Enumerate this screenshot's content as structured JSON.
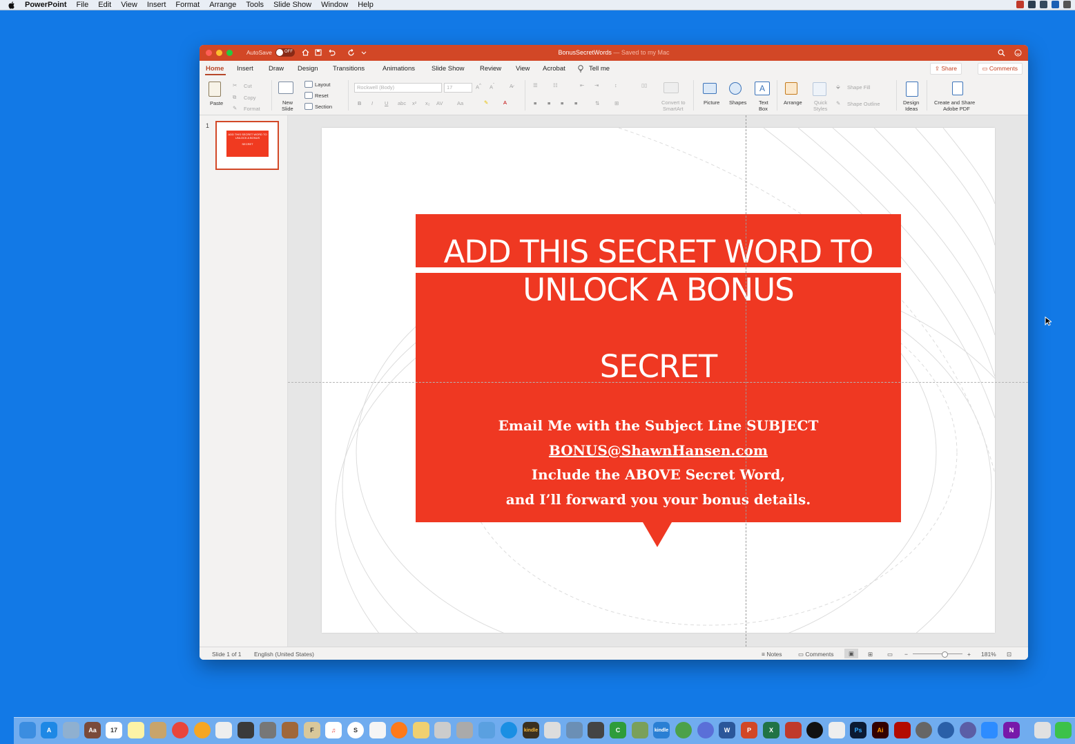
{
  "menubar": {
    "app_name": "PowerPoint",
    "items": [
      "File",
      "Edit",
      "View",
      "Insert",
      "Format",
      "Arrange",
      "Tools",
      "Slide Show",
      "Window",
      "Help"
    ]
  },
  "titlebar": {
    "autosave_label": "AutoSave",
    "autosave_state": "OFF",
    "document_name": "BonusSecretWords",
    "save_status": "— Saved to my Mac",
    "accent_color": "#d24726"
  },
  "tabs": {
    "items": [
      "Home",
      "Insert",
      "Draw",
      "Design",
      "Transitions",
      "Animations",
      "Slide Show",
      "Review",
      "View",
      "Acrobat"
    ],
    "active": "Home",
    "tell_me": "Tell me",
    "share_label": "Share",
    "comments_label": "Comments"
  },
  "ribbon": {
    "paste": "Paste",
    "cut": "Cut",
    "copy": "Copy",
    "format": "Format",
    "new_slide_1": "New",
    "new_slide_2": "Slide",
    "layout": "Layout",
    "reset": "Reset",
    "section": "Section",
    "font_name": "Rockwell (Body)",
    "font_size": "17",
    "convert_smartart_1": "Convert to",
    "convert_smartart_2": "SmartArt",
    "picture": "Picture",
    "shapes": "Shapes",
    "text_box_1": "Text",
    "text_box_2": "Box",
    "arrange": "Arrange",
    "quick_styles_1": "Quick",
    "quick_styles_2": "Styles",
    "shape_fill": "Shape Fill",
    "shape_outline": "Shape Outline",
    "design_ideas_1": "Design",
    "design_ideas_2": "Ideas",
    "adobe_pdf_1": "Create and Share",
    "adobe_pdf_2": "Adobe PDF"
  },
  "thumbnails": {
    "slide_number": "1",
    "thumb_line1": "ADD THIS SECRET WORD TO",
    "thumb_line2": "UNLOCK A BONUS",
    "thumb_line3": "SECRET"
  },
  "slide": {
    "headline_line1": "ADD THIS SECRET WORD TO",
    "headline_line2": "UNLOCK A BONUS",
    "secret_word": "SECRET",
    "line1": "Email Me with the Subject Line SUBJECT",
    "email": "BONUS@ShawnHansen.com",
    "line3": "Include the ABOVE Secret Word,",
    "line4": "and I’ll forward you your bonus details.",
    "box_color": "#ef3822"
  },
  "statusbar": {
    "slide_info": "Slide 1 of 1",
    "language": "English (United States)",
    "notes": "Notes",
    "comments": "Comments",
    "zoom": "181%"
  },
  "dock": {
    "labels": [
      "Ps",
      "Ai",
      "W",
      "P",
      "X",
      "N"
    ],
    "colors": {
      "finder": "#3b8de0",
      "appstore": "#1e88e5",
      "chrome": "#e8453c",
      "firefox": "#ff7a1a",
      "word": "#2b579a",
      "powerpoint": "#d24726",
      "excel": "#217346",
      "photoshop": "#0b1a33",
      "illustrator": "#330000",
      "onenote": "#7719aa",
      "messages": "#3cc24a"
    }
  }
}
